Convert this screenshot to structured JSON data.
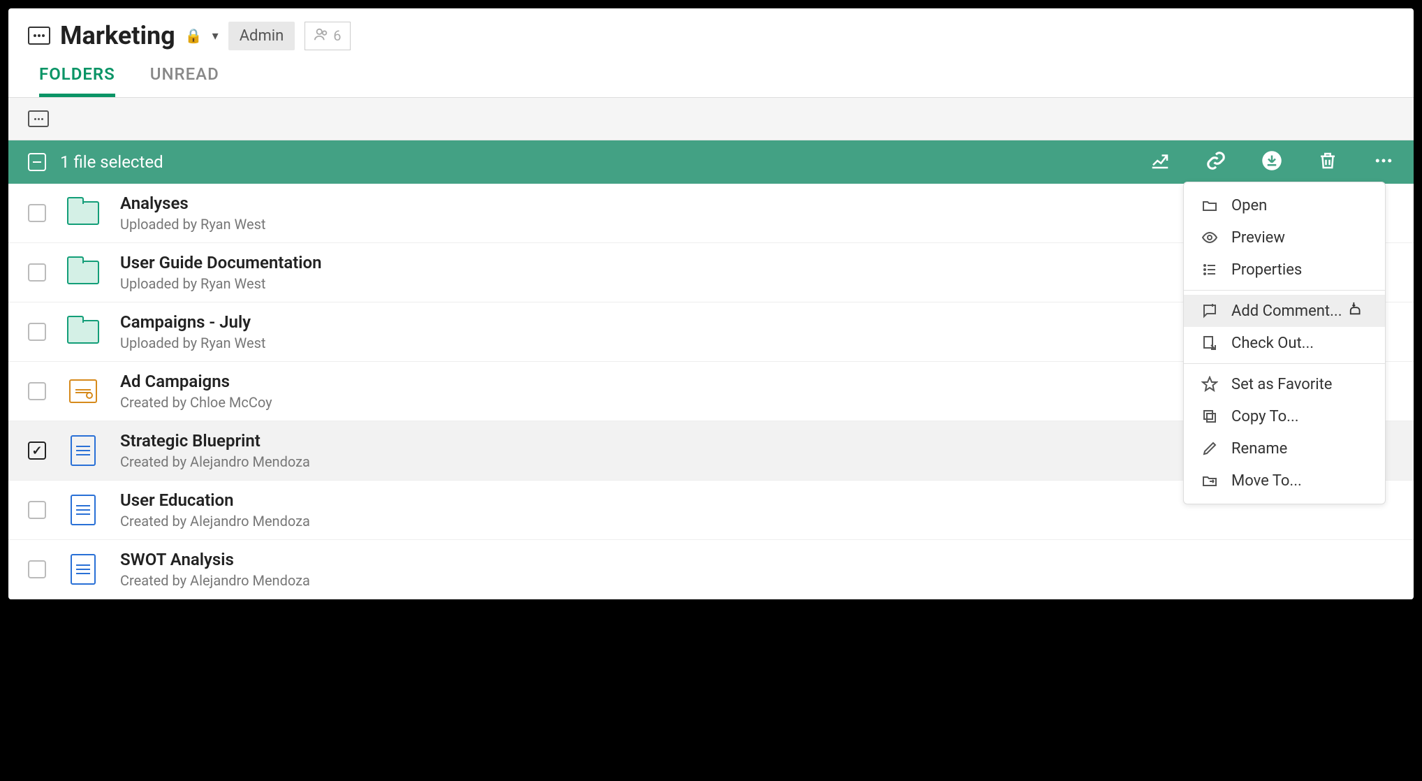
{
  "header": {
    "title": "Marketing",
    "role_chip": "Admin",
    "member_count": "6"
  },
  "tabs": {
    "folders": "FOLDERS",
    "unread": "UNREAD"
  },
  "selection_bar": {
    "text": "1 file selected"
  },
  "items": [
    {
      "type": "folder",
      "name": "Analyses",
      "meta": "Uploaded by Ryan West",
      "selected": false
    },
    {
      "type": "folder",
      "name": "User Guide Documentation",
      "meta": "Uploaded by Ryan West",
      "selected": false
    },
    {
      "type": "folder",
      "name": "Campaigns - July",
      "meta": "Uploaded by Ryan West",
      "selected": false
    },
    {
      "type": "doc_orange",
      "name": "Ad Campaigns",
      "meta": "Created by Chloe McCoy",
      "selected": false
    },
    {
      "type": "doc_blue",
      "name": "Strategic Blueprint",
      "meta": "Created by Alejandro Mendoza",
      "selected": true
    },
    {
      "type": "doc_blue",
      "name": "User Education",
      "meta": "Created by Alejandro Mendoza",
      "selected": false
    },
    {
      "type": "doc_blue",
      "name": "SWOT Analysis",
      "meta": "Created by Alejandro Mendoza",
      "selected": false
    }
  ],
  "context_menu": {
    "open": "Open",
    "preview": "Preview",
    "properties": "Properties",
    "add_comment": "Add Comment...",
    "check_out": "Check Out...",
    "set_favorite": "Set as Favorite",
    "copy_to": "Copy To...",
    "rename": "Rename",
    "move_to": "Move To..."
  }
}
